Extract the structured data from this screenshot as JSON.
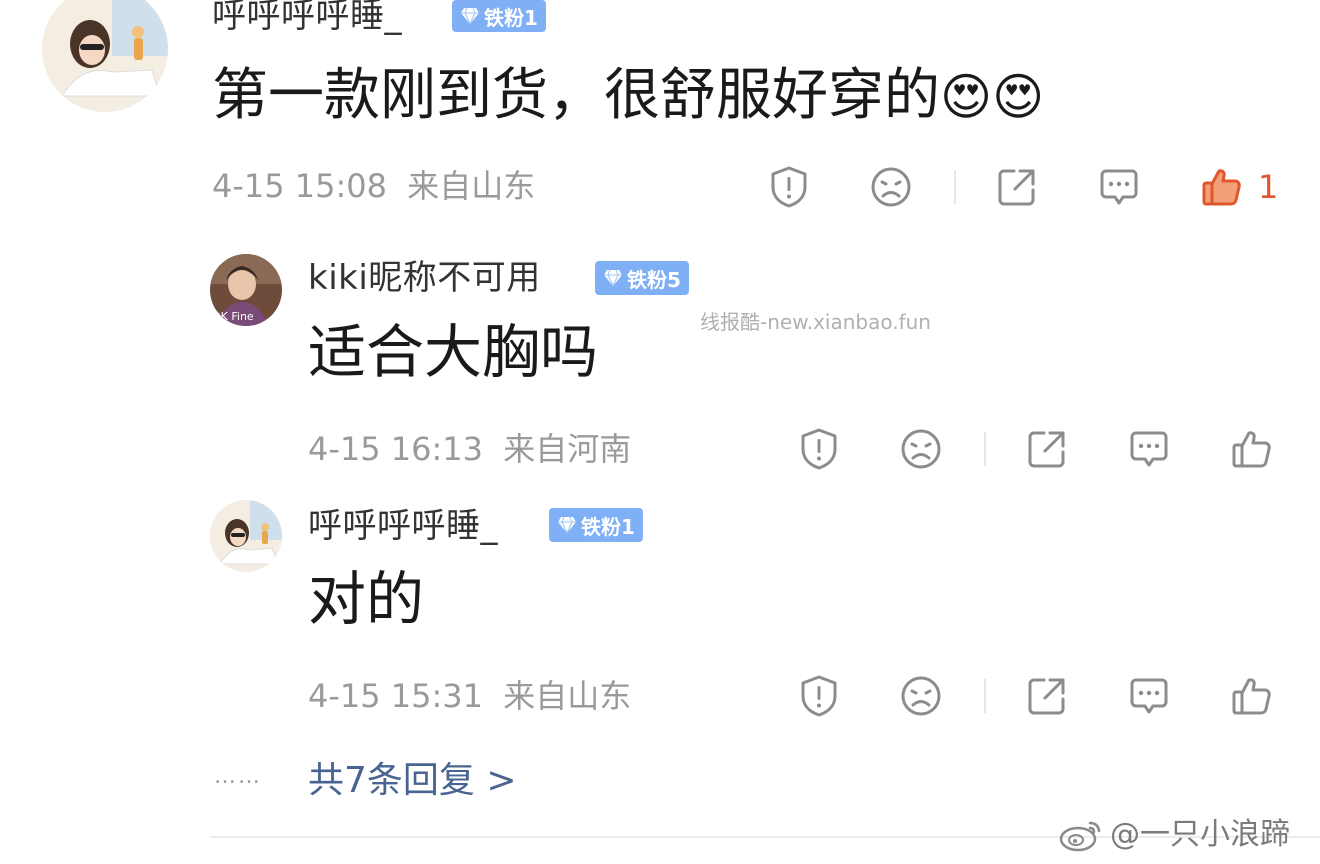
{
  "comments": [
    {
      "username": "呼呼呼呼睡_",
      "badge": "铁粉1",
      "text": "第一款刚到货，很舒服好穿的",
      "emoji": "😍😍",
      "time": "4-15 15:08",
      "location": "来自山东",
      "like_count": "1",
      "liked": true
    },
    {
      "username": "kiki昵称不可用",
      "badge": "铁粉5",
      "avatar_text": "OK Fine",
      "text": "适合大胸吗",
      "time": "4-15 16:13",
      "location": "来自河南",
      "liked": false
    },
    {
      "username": "呼呼呼呼睡_",
      "badge": "铁粉1",
      "text": "对的",
      "time": "4-15 15:31",
      "location": "来自山东",
      "liked": false
    }
  ],
  "more_replies": {
    "dots": "……",
    "label": "共7条回复 >"
  },
  "watermark": "线报酷-new.xianbao.fun",
  "footer_watermark": "@一只小浪蹄",
  "colors": {
    "badge_bg": "#7fb0f5",
    "like_active": "#e0572c",
    "icon_gray": "#8c8c8c",
    "link_blue": "#4a6491"
  },
  "icons": [
    "report-icon",
    "dislike-face-icon",
    "share-icon",
    "comment-icon",
    "thumbs-up-icon",
    "diamond-icon",
    "weibo-logo-icon"
  ]
}
